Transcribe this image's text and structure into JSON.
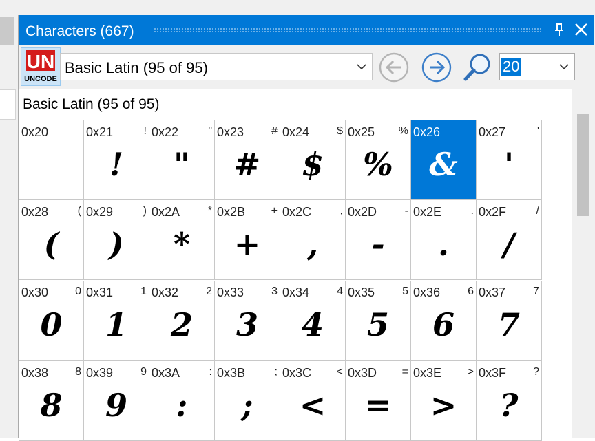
{
  "window": {
    "title": "Characters (667)",
    "colors": {
      "titlebar": "#0078d7",
      "selection": "#0078d7"
    }
  },
  "toolbar": {
    "logo_letters": "UN",
    "logo_word": "UNCODE",
    "block_select": {
      "value": "Basic Latin (95 of 95)"
    },
    "size_select": {
      "value": "20"
    },
    "icons": [
      "unicode-logo-icon",
      "back-arrow-icon",
      "forward-arrow-icon",
      "search-icon"
    ]
  },
  "section": {
    "title": "Basic Latin (95 of 95)"
  },
  "characters": [
    {
      "code": "0x20",
      "small": "",
      "glyph": ""
    },
    {
      "code": "0x21",
      "small": "!",
      "glyph": "!"
    },
    {
      "code": "0x22",
      "small": "\"",
      "glyph": "\""
    },
    {
      "code": "0x23",
      "small": "#",
      "glyph": "#"
    },
    {
      "code": "0x24",
      "small": "$",
      "glyph": "$"
    },
    {
      "code": "0x25",
      "small": "%",
      "glyph": "%"
    },
    {
      "code": "0x26",
      "small": "",
      "glyph": "&",
      "selected": true
    },
    {
      "code": "0x27",
      "small": "'",
      "glyph": "'"
    },
    {
      "code": "0x28",
      "small": "(",
      "glyph": "("
    },
    {
      "code": "0x29",
      "small": ")",
      "glyph": ")"
    },
    {
      "code": "0x2A",
      "small": "*",
      "glyph": "*"
    },
    {
      "code": "0x2B",
      "small": "+",
      "glyph": "+"
    },
    {
      "code": "0x2C",
      "small": ",",
      "glyph": ","
    },
    {
      "code": "0x2D",
      "small": "-",
      "glyph": "-"
    },
    {
      "code": "0x2E",
      "small": ".",
      "glyph": "."
    },
    {
      "code": "0x2F",
      "small": "/",
      "glyph": "/"
    },
    {
      "code": "0x30",
      "small": "0",
      "glyph": "0"
    },
    {
      "code": "0x31",
      "small": "1",
      "glyph": "1"
    },
    {
      "code": "0x32",
      "small": "2",
      "glyph": "2"
    },
    {
      "code": "0x33",
      "small": "3",
      "glyph": "3"
    },
    {
      "code": "0x34",
      "small": "4",
      "glyph": "4"
    },
    {
      "code": "0x35",
      "small": "5",
      "glyph": "5"
    },
    {
      "code": "0x36",
      "small": "6",
      "glyph": "6"
    },
    {
      "code": "0x37",
      "small": "7",
      "glyph": "7"
    },
    {
      "code": "0x38",
      "small": "8",
      "glyph": "8"
    },
    {
      "code": "0x39",
      "small": "9",
      "glyph": "9"
    },
    {
      "code": "0x3A",
      "small": ":",
      "glyph": ":"
    },
    {
      "code": "0x3B",
      "small": ";",
      "glyph": ";"
    },
    {
      "code": "0x3C",
      "small": "<",
      "glyph": "<"
    },
    {
      "code": "0x3D",
      "small": "=",
      "glyph": "="
    },
    {
      "code": "0x3E",
      "small": ">",
      "glyph": ">"
    },
    {
      "code": "0x3F",
      "small": "?",
      "glyph": "?"
    }
  ]
}
